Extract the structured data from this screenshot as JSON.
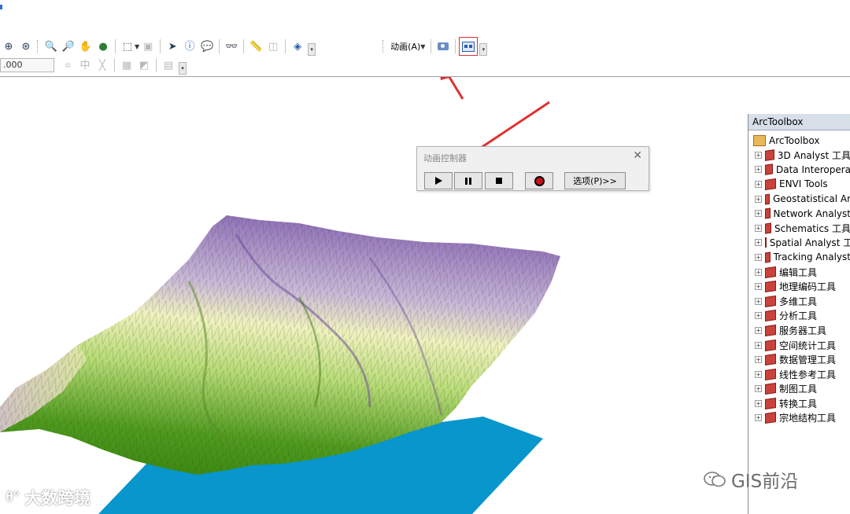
{
  "toolbar": {
    "row1_icons": [
      "full-extent-icon",
      "fixed-zoom-icon",
      "zoom-in-icon",
      "zoom-out-icon",
      "pan-icon",
      "globe-icon",
      "navigate-icon",
      "select-icon",
      "identify-icon",
      "html-popup-icon",
      "find-icon",
      "measure-icon",
      "layer-icon",
      "3d-view-icon"
    ],
    "animation_menu_label": "动画(A)",
    "scale_value": ".000"
  },
  "animation_controller": {
    "title": "动画控制器",
    "options_label": "选项(P)>>"
  },
  "arctoolbox": {
    "title": "ArcToolbox",
    "root_label": "ArcToolbox",
    "items": [
      {
        "label": "3D Analyst 工具"
      },
      {
        "label": "Data Interopera"
      },
      {
        "label": "ENVI Tools"
      },
      {
        "label": "Geostatistical Ar"
      },
      {
        "label": "Network Analyst"
      },
      {
        "label": "Schematics 工具"
      },
      {
        "label": "Spatial Analyst 工"
      },
      {
        "label": "Tracking Analyst"
      },
      {
        "label": "编辑工具"
      },
      {
        "label": "地理编码工具"
      },
      {
        "label": "多维工具"
      },
      {
        "label": "分析工具"
      },
      {
        "label": "服务器工具"
      },
      {
        "label": "空间统计工具"
      },
      {
        "label": "数据管理工具"
      },
      {
        "label": "线性参考工具"
      },
      {
        "label": "制图工具"
      },
      {
        "label": "转换工具"
      },
      {
        "label": "宗地结构工具"
      }
    ]
  },
  "watermarks": {
    "left": "大数跨境",
    "right": "GIS前沿"
  },
  "colors": {
    "annotation_red": "#e03030",
    "water_blue": "#0896cc",
    "terrain_green": "#4f9a1e",
    "terrain_purple": "#7e5aa6",
    "terrain_cream": "#eef0b6"
  }
}
